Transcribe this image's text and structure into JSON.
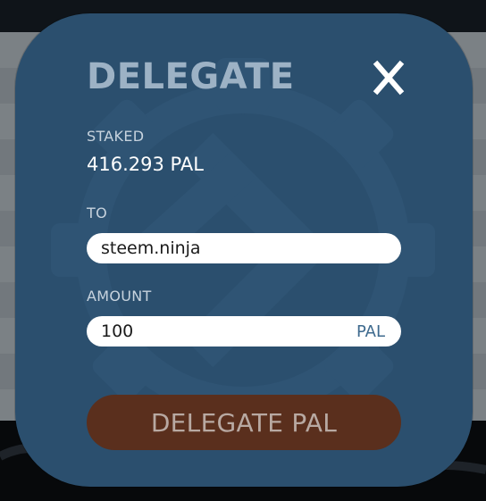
{
  "modal": {
    "title": "DELEGATE",
    "close_glyph": "X",
    "close_icon": "close-icon",
    "watermark_icon": "gear-chevron-logo",
    "staked": {
      "label": "STAKED",
      "value": "416.293 PAL"
    },
    "to": {
      "label": "TO",
      "value": "steem.ninja"
    },
    "amount": {
      "label": "AMOUNT",
      "value": "100",
      "unit": "PAL"
    },
    "submit_label": "DELEGATE PAL"
  },
  "colors": {
    "modal_bg": "#2b4f6e",
    "title": "#9db2c5",
    "button_bg": "#5a2f1d",
    "button_text": "#b8a9a2",
    "unit_text": "#3e6a8e"
  }
}
